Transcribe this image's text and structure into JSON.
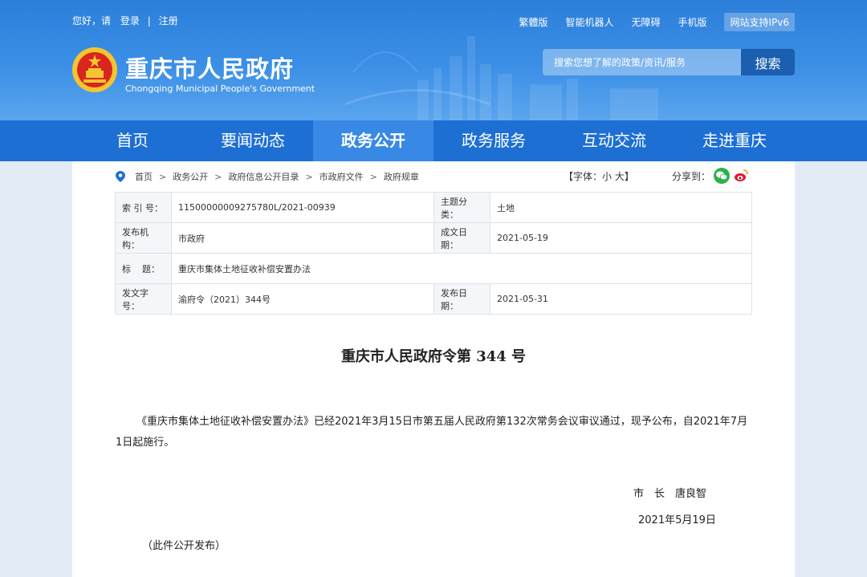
{
  "topbar": {
    "greeting": "您好，请",
    "login": "登录",
    "divider": "|",
    "register": "注册",
    "links": [
      "繁體版",
      "智能机器人",
      "无障碍",
      "手机版",
      "网站支持IPv6"
    ]
  },
  "header": {
    "title": "重庆市人民政府",
    "subtitle": "Chongqing Municipal People's Government",
    "search_placeholder": "搜索您想了解的政策/资讯/服务",
    "search_button": "搜索"
  },
  "nav": {
    "items": [
      "首页",
      "要闻动态",
      "政务公开",
      "政务服务",
      "互动交流",
      "走进重庆"
    ],
    "active": "政务公开"
  },
  "breadcrumb": {
    "items": [
      "首页",
      "政务公开",
      "政府信息公开目录",
      "市政府文件",
      "政府规章"
    ],
    "arrow": ">"
  },
  "fontsize": {
    "text": "【字体：小 大】"
  },
  "share": {
    "label": "分享到："
  },
  "meta": {
    "index_label": "索 引 号：",
    "index_value": "11500000009275780L/2021-00939",
    "category_label": "主题分类：",
    "category_value": "土地",
    "issuer_label": "发布机构：",
    "issuer_value": "市政府",
    "written_label": "成文日期：",
    "written_value": "2021-05-19",
    "title_label": "标    题：",
    "title_value": "重庆市集体土地征收补偿安置办法",
    "docno_label": "发文字号：",
    "docno_value": "渝府令（2021）344号",
    "published_label": "发布日期：",
    "published_value": "2021-05-31"
  },
  "document": {
    "title": "重庆市人民政府令第 344 号",
    "body": "《重庆市集体土地征收补偿安置办法》已经2021年3月15日市第五届人民政府第132次常务会议审议通过，现予公布，自2021年7月1日起施行。",
    "signature": "市　长　唐良智",
    "date": "2021年5月19日",
    "note": "（此件公开发布）"
  },
  "colors": {
    "header_blue": "#3b8fe6",
    "nav_blue": "#1d6fd4",
    "nav_active": "#3889e6",
    "wechat": "#2ab24a",
    "weibo": "#e6162d"
  }
}
